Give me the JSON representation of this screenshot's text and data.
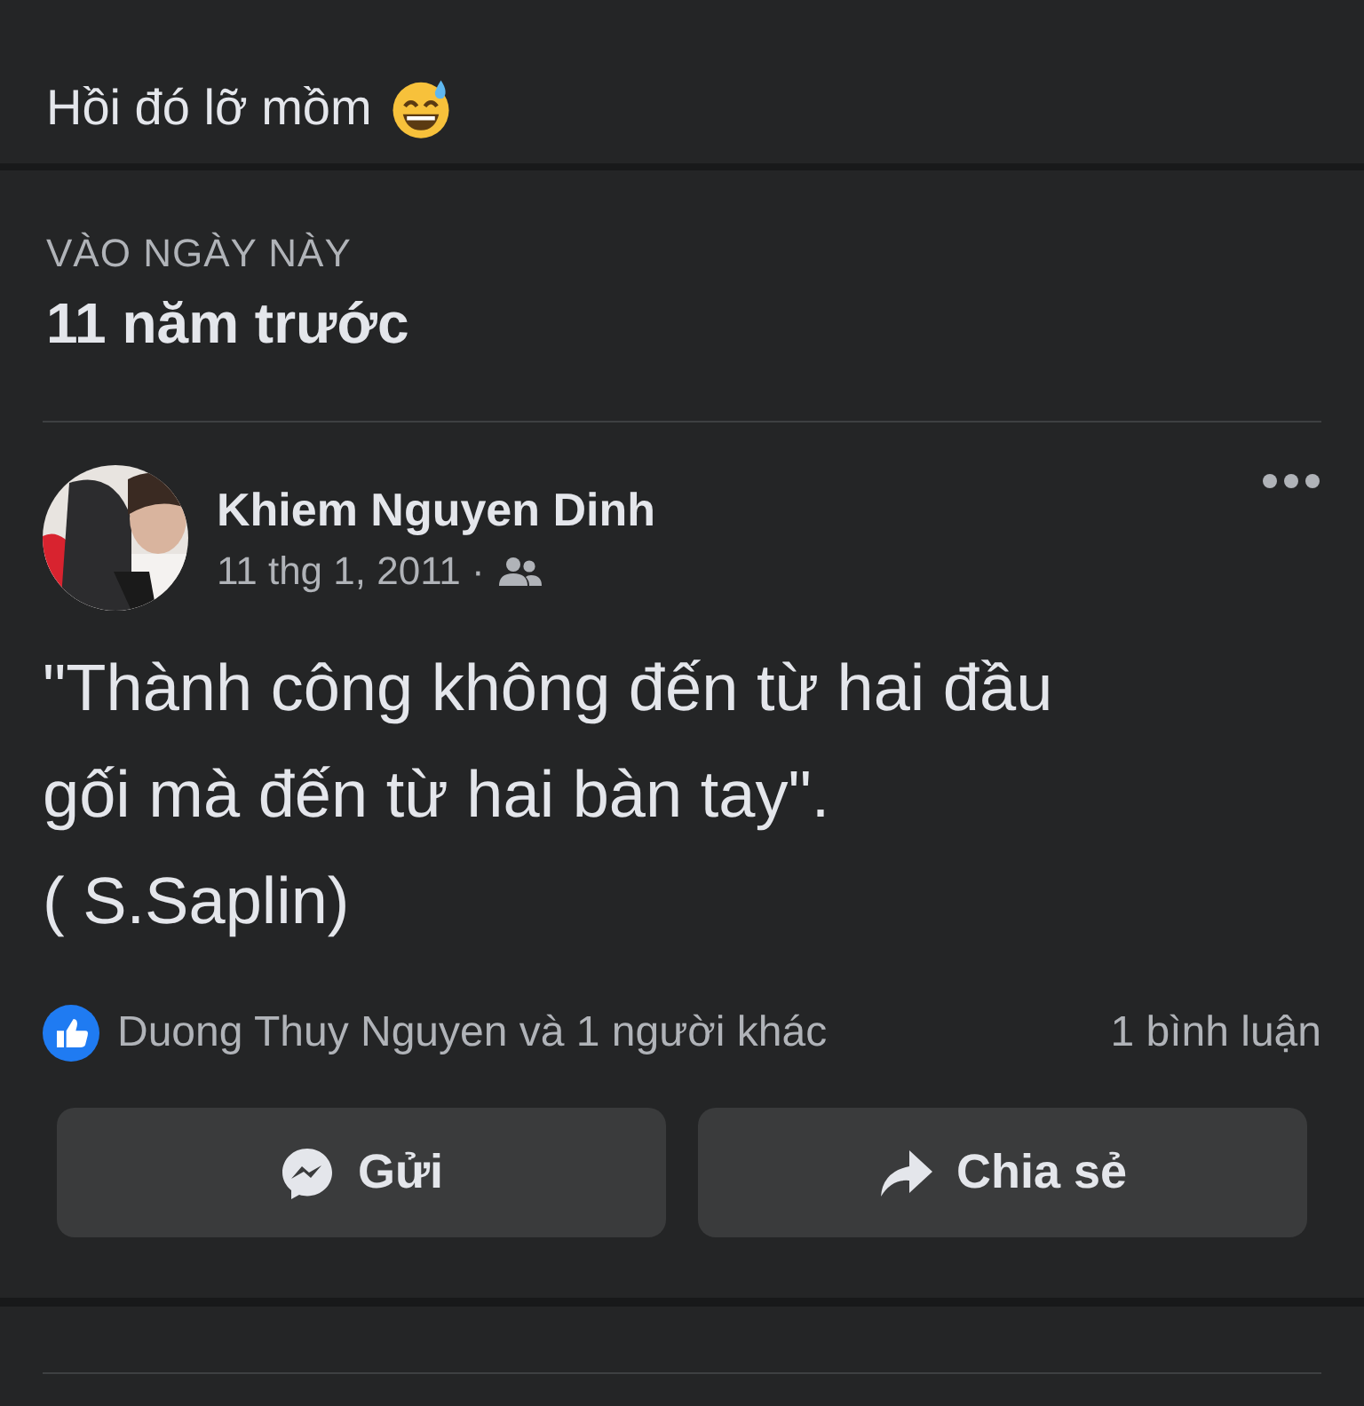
{
  "top_post": {
    "text": "Hồi đó lỡ mồm"
  },
  "memory": {
    "label": "VÀO NGÀY NÀY",
    "title": "11 năm trước"
  },
  "post": {
    "author": "Khiem Nguyen Dinh",
    "date": "11 thg 1, 2011 ·",
    "body": "\"Thành công không đến từ hai đầu\ngối mà đến từ hai bàn tay\".\n( S.Saplin)",
    "reactions": "Duong Thuy Nguyen và 1 người khác",
    "comments": "1 bình luận",
    "buttons": [
      {
        "kind": "send",
        "label": "Gửi"
      },
      {
        "kind": "share",
        "label": "Chia sẻ"
      }
    ]
  }
}
